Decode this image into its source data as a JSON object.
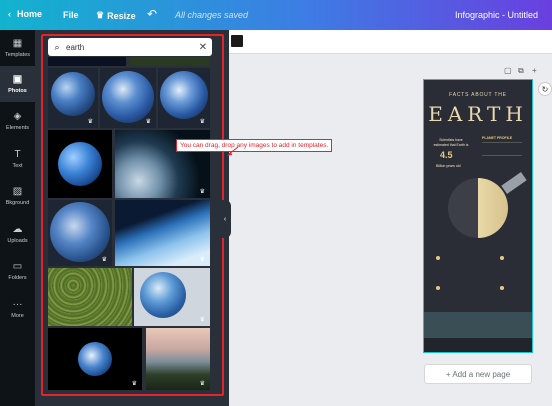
{
  "topbar": {
    "home_label": "Home",
    "file_label": "File",
    "resize_label": "Resize",
    "status": "All changes saved",
    "doc_title": "Infographic - Untitled"
  },
  "sidebar": {
    "items": [
      {
        "label": "Templates",
        "icon": "templates-icon"
      },
      {
        "label": "Photos",
        "icon": "photos-icon"
      },
      {
        "label": "Elements",
        "icon": "elements-icon"
      },
      {
        "label": "Text",
        "icon": "text-icon"
      },
      {
        "label": "Bkground",
        "icon": "background-icon"
      },
      {
        "label": "Uploads",
        "icon": "uploads-icon"
      },
      {
        "label": "Folders",
        "icon": "folders-icon"
      },
      {
        "label": "More",
        "icon": "more-icon"
      }
    ],
    "active": "Photos"
  },
  "search": {
    "value": "earth"
  },
  "annotation": {
    "callout": "You can drag, drop any images to add in templates."
  },
  "infographic": {
    "subtitle": "FACTS ABOUT THE",
    "title": "EARTH",
    "scientists_text": "Scientists have estimated that Earth is",
    "age_value": "4.5",
    "age_unit": "Billion years old",
    "profile_title": "PLANET PROFILE"
  },
  "canvas": {
    "add_page_label": "+ Add a new page"
  },
  "colors": {
    "accent": "#e3242b",
    "panel": "#293039",
    "rail": "#0e1318",
    "infographic_bg": "#2b2d36",
    "infographic_text": "#e9d9b0"
  }
}
